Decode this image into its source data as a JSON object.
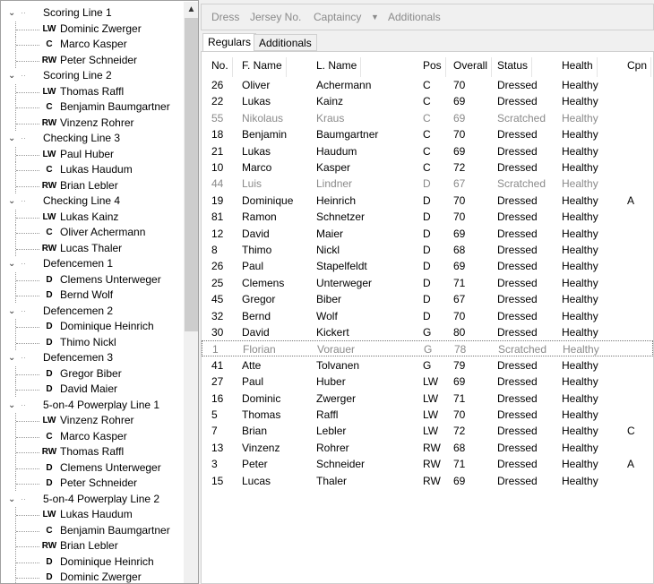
{
  "tree": {
    "groups": [
      {
        "label": "Scoring Line 1",
        "players": [
          [
            "LW",
            "Dominic Zwerger"
          ],
          [
            "C",
            "Marco Kasper"
          ],
          [
            "RW",
            "Peter Schneider"
          ]
        ]
      },
      {
        "label": "Scoring Line 2",
        "players": [
          [
            "LW",
            "Thomas Raffl"
          ],
          [
            "C",
            "Benjamin Baumgartner"
          ],
          [
            "RW",
            "Vinzenz Rohrer"
          ]
        ]
      },
      {
        "label": "Checking Line 3",
        "players": [
          [
            "LW",
            "Paul Huber"
          ],
          [
            "C",
            "Lukas Haudum"
          ],
          [
            "RW",
            "Brian Lebler"
          ]
        ]
      },
      {
        "label": "Checking Line 4",
        "players": [
          [
            "LW",
            "Lukas Kainz"
          ],
          [
            "C",
            "Oliver Achermann"
          ],
          [
            "RW",
            "Lucas Thaler"
          ]
        ]
      },
      {
        "label": "Defencemen 1",
        "players": [
          [
            "D",
            "Clemens Unterweger"
          ],
          [
            "D",
            "Bernd Wolf"
          ]
        ]
      },
      {
        "label": "Defencemen 2",
        "players": [
          [
            "D",
            "Dominique Heinrich"
          ],
          [
            "D",
            "Thimo Nickl"
          ]
        ]
      },
      {
        "label": "Defencemen 3",
        "players": [
          [
            "D",
            "Gregor Biber"
          ],
          [
            "D",
            "David Maier"
          ]
        ]
      },
      {
        "label": "5-on-4 Powerplay Line 1",
        "players": [
          [
            "LW",
            "Vinzenz Rohrer"
          ],
          [
            "C",
            "Marco Kasper"
          ],
          [
            "RW",
            "Thomas Raffl"
          ],
          [
            "D",
            "Clemens Unterweger"
          ],
          [
            "D",
            "Peter Schneider"
          ]
        ]
      },
      {
        "label": "5-on-4 Powerplay Line 2",
        "players": [
          [
            "LW",
            "Lukas Haudum"
          ],
          [
            "C",
            "Benjamin Baumgartner"
          ],
          [
            "RW",
            "Brian Lebler"
          ],
          [
            "D",
            "Dominique Heinrich"
          ],
          [
            "D",
            "Dominic Zwerger"
          ]
        ]
      }
    ]
  },
  "toolbar": {
    "dress": "Dress",
    "jersey": "Jersey No.",
    "captaincy": "Captaincy",
    "captaincy_arrow": "▼",
    "additionals": "Additionals"
  },
  "tabs": [
    "Regulars",
    "Additionals"
  ],
  "table": {
    "headers": [
      "No.",
      "F. Name",
      "L. Name",
      "Pos",
      "Overall",
      "Status",
      "Health",
      "Cpn"
    ],
    "rows": [
      [
        "26",
        "Oliver",
        "Achermann",
        "C",
        "70",
        "Dressed",
        "Healthy",
        ""
      ],
      [
        "22",
        "Lukas",
        "Kainz",
        "C",
        "69",
        "Dressed",
        "Healthy",
        ""
      ],
      [
        "55",
        "Nikolaus",
        "Kraus",
        "C",
        "69",
        "Scratched",
        "Healthy",
        ""
      ],
      [
        "18",
        "Benjamin",
        "Baumgartner",
        "C",
        "70",
        "Dressed",
        "Healthy",
        ""
      ],
      [
        "21",
        "Lukas",
        "Haudum",
        "C",
        "69",
        "Dressed",
        "Healthy",
        ""
      ],
      [
        "10",
        "Marco",
        "Kasper",
        "C",
        "72",
        "Dressed",
        "Healthy",
        ""
      ],
      [
        "44",
        "Luis",
        "Lindner",
        "D",
        "67",
        "Scratched",
        "Healthy",
        ""
      ],
      [
        "19",
        "Dominique",
        "Heinrich",
        "D",
        "70",
        "Dressed",
        "Healthy",
        "A"
      ],
      [
        "81",
        "Ramon",
        "Schnetzer",
        "D",
        "70",
        "Dressed",
        "Healthy",
        ""
      ],
      [
        "12",
        "David",
        "Maier",
        "D",
        "69",
        "Dressed",
        "Healthy",
        ""
      ],
      [
        "8",
        "Thimo",
        "Nickl",
        "D",
        "68",
        "Dressed",
        "Healthy",
        ""
      ],
      [
        "26",
        "Paul",
        "Stapelfeldt",
        "D",
        "69",
        "Dressed",
        "Healthy",
        ""
      ],
      [
        "25",
        "Clemens",
        "Unterweger",
        "D",
        "71",
        "Dressed",
        "Healthy",
        ""
      ],
      [
        "45",
        "Gregor",
        "Biber",
        "D",
        "67",
        "Dressed",
        "Healthy",
        ""
      ],
      [
        "32",
        "Bernd",
        "Wolf",
        "D",
        "70",
        "Dressed",
        "Healthy",
        ""
      ],
      [
        "30",
        "David",
        "Kickert",
        "G",
        "80",
        "Dressed",
        "Healthy",
        ""
      ],
      [
        "1",
        "Florian",
        "Vorauer",
        "G",
        "78",
        "Scratched",
        "Healthy",
        ""
      ],
      [
        "41",
        "Atte",
        "Tolvanen",
        "G",
        "79",
        "Dressed",
        "Healthy",
        ""
      ],
      [
        "27",
        "Paul",
        "Huber",
        "LW",
        "69",
        "Dressed",
        "Healthy",
        ""
      ],
      [
        "16",
        "Dominic",
        "Zwerger",
        "LW",
        "71",
        "Dressed",
        "Healthy",
        ""
      ],
      [
        "5",
        "Thomas",
        "Raffl",
        "LW",
        "70",
        "Dressed",
        "Healthy",
        ""
      ],
      [
        "7",
        "Brian",
        "Lebler",
        "LW",
        "72",
        "Dressed",
        "Healthy",
        "C"
      ],
      [
        "13",
        "Vinzenz",
        "Rohrer",
        "RW",
        "68",
        "Dressed",
        "Healthy",
        ""
      ],
      [
        "3",
        "Peter",
        "Schneider",
        "RW",
        "71",
        "Dressed",
        "Healthy",
        "A"
      ],
      [
        "15",
        "Lucas",
        "Thaler",
        "RW",
        "69",
        "Dressed",
        "Healthy",
        ""
      ]
    ],
    "focused_row": 16
  }
}
